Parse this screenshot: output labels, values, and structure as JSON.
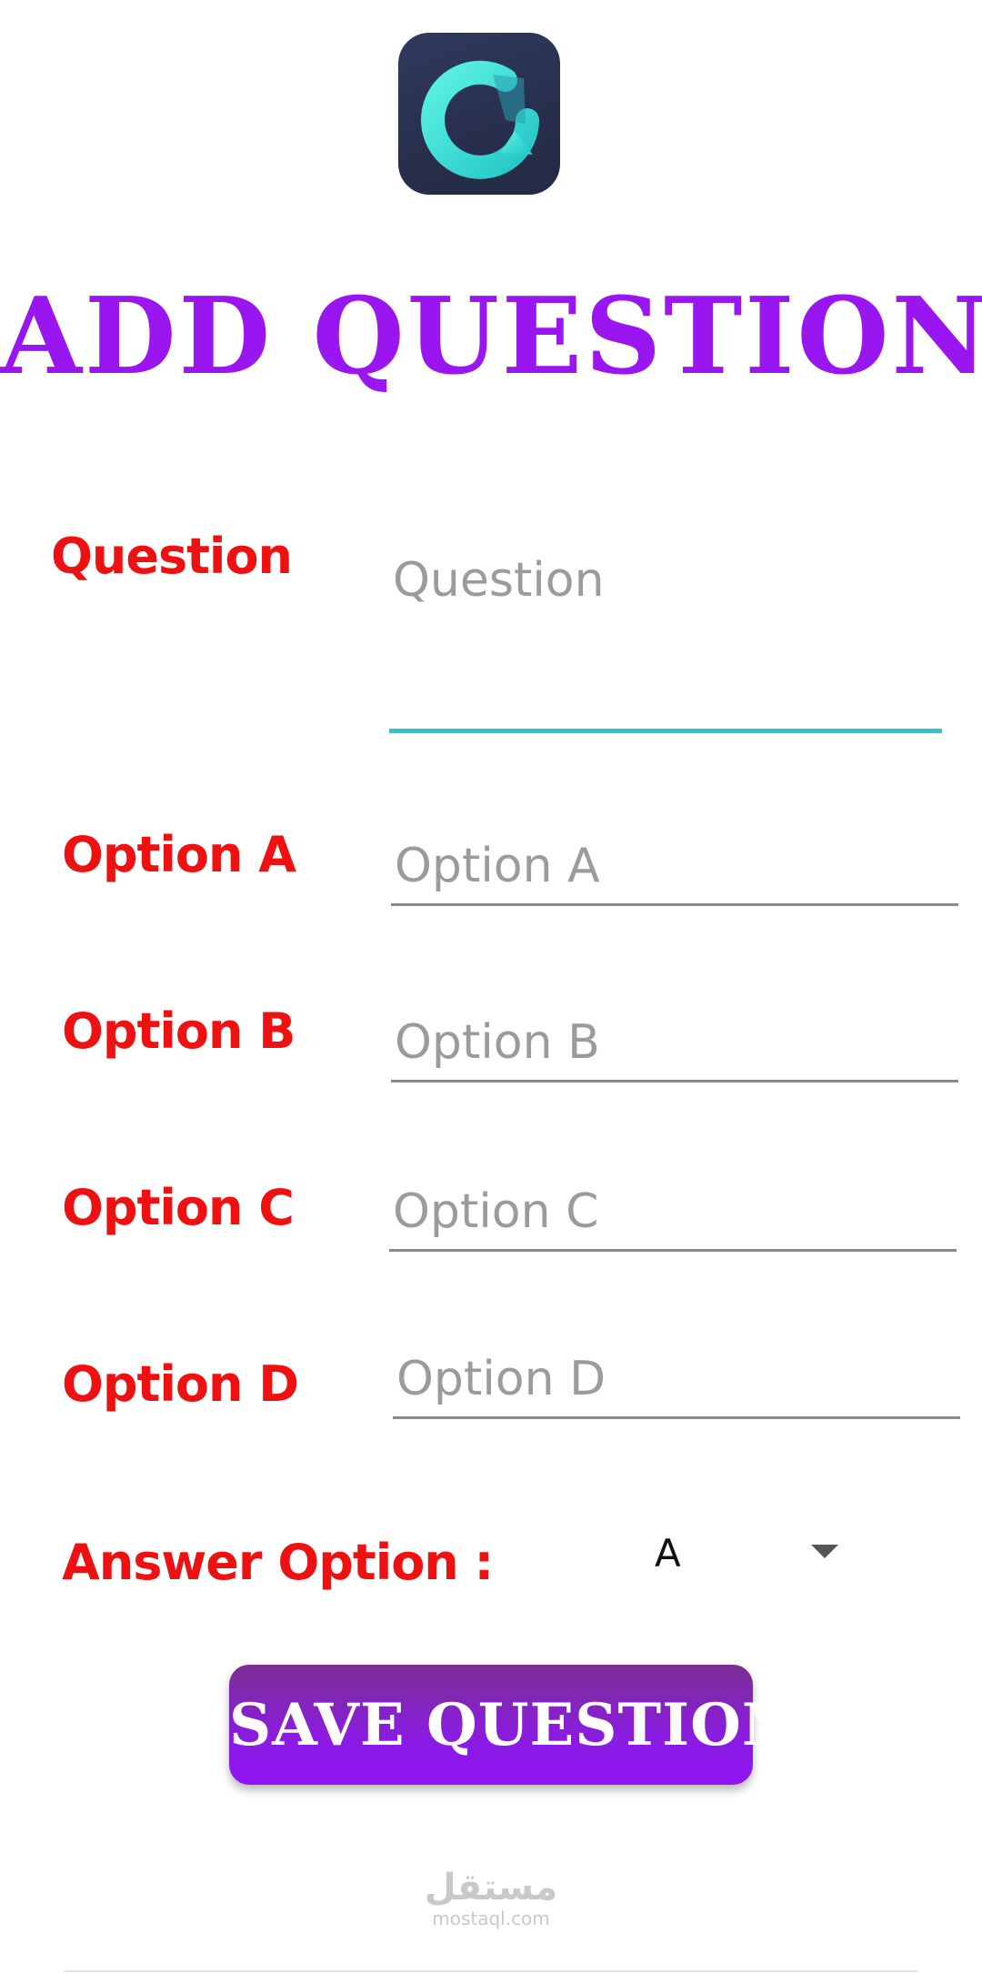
{
  "header": {
    "logo_icon": "app-logo-q-icon",
    "title": "ADD QUESTION"
  },
  "form": {
    "question": {
      "label": "Question",
      "placeholder": "Question",
      "value": ""
    },
    "option_a": {
      "label": "Option A",
      "placeholder": "Option A",
      "value": ""
    },
    "option_b": {
      "label": "Option B",
      "placeholder": "Option B",
      "value": ""
    },
    "option_c": {
      "label": "Option C",
      "placeholder": "Option C",
      "value": ""
    },
    "option_d": {
      "label": "Option D",
      "placeholder": "Option D",
      "value": ""
    },
    "answer": {
      "label": "Answer Option :",
      "selected": "A",
      "icon": "dropdown-arrow-icon"
    }
  },
  "actions": {
    "save_label": "SAVE QUESTION"
  },
  "watermark": {
    "arabic": "مستقل",
    "latin": "mostaql.com"
  },
  "colors": {
    "title": "#9a16f0",
    "label": "#ee1111",
    "focused_underline": "#2cc7c9",
    "button": "#8a1ce0",
    "logo_background": "#272f4c",
    "logo_mark": "#3de3d6"
  }
}
